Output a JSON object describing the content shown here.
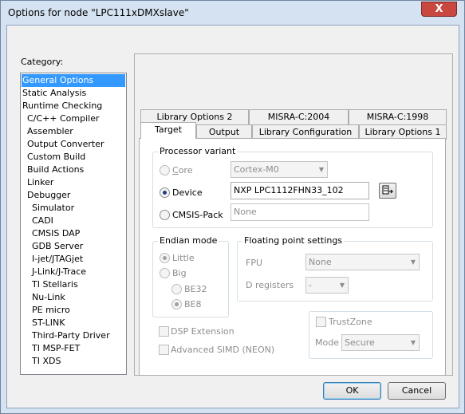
{
  "window": {
    "title": "Options for node \"LPC111xDMXslave\"",
    "close_glyph": "X"
  },
  "category": {
    "label": "Category:",
    "items": [
      "General Options",
      "Static Analysis",
      "Runtime Checking",
      "C/C++ Compiler",
      "Assembler",
      "Output Converter",
      "Custom Build",
      "Build Actions",
      "Linker",
      "Debugger",
      "Simulator",
      "CADI",
      "CMSIS DAP",
      "GDB Server",
      "I-jet/JTAGjet",
      "J-Link/J-Trace",
      "TI Stellaris",
      "Nu-Link",
      "PE micro",
      "ST-LINK",
      "Third-Party Driver",
      "TI MSP-FET",
      "TI XDS"
    ],
    "selected": "General Options"
  },
  "tabs": {
    "row_back": [
      "Library Options 2",
      "MISRA-C:2004",
      "MISRA-C:1998"
    ],
    "row_front": [
      "Target",
      "Output",
      "Library Configuration",
      "Library Options 1"
    ],
    "active": "Target"
  },
  "processor": {
    "title": "Processor variant",
    "core_label": "Core",
    "core_value": "Cortex-M0",
    "device_label": "Device",
    "device_value": "NXP LPC1112FHN33_102",
    "cmsis_label": "CMSIS-Pack",
    "cmsis_value": "None",
    "selected": "Device"
  },
  "endian": {
    "title": "Endian mode",
    "little": "Little",
    "big": "Big",
    "be32": "BE32",
    "be8": "BE8"
  },
  "fpu": {
    "title": "Floating point settings",
    "fpu_label": "FPU",
    "fpu_value": "None",
    "dreg_label": "D registers",
    "dreg_value": "-"
  },
  "options": {
    "dsp": "DSP Extension",
    "simd": "Advanced SIMD (NEON)",
    "trustzone": "TrustZone",
    "mode_label": "Mode",
    "mode_value": "Secure"
  },
  "buttons": {
    "ok": "OK",
    "cancel": "Cancel"
  }
}
